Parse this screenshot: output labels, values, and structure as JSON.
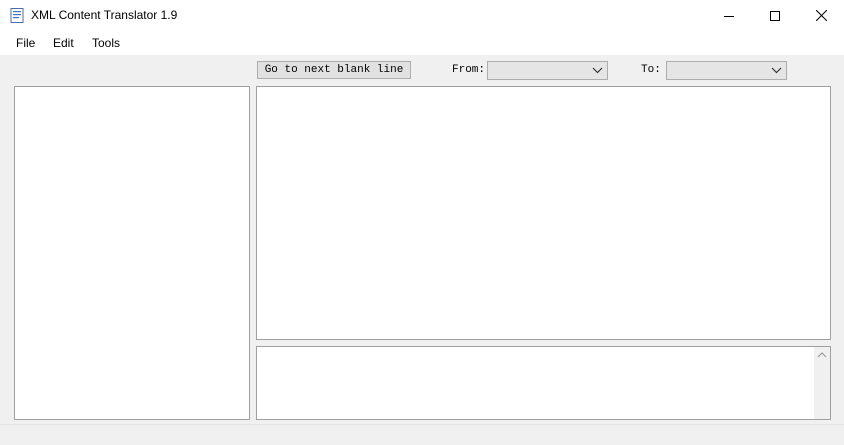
{
  "window": {
    "title": "XML Content Translator 1.9",
    "icons": [
      "app-icon",
      "minimize-icon",
      "maximize-icon",
      "close-icon"
    ]
  },
  "menu": {
    "file": "File",
    "edit": "Edit",
    "tools": "Tools"
  },
  "toolbar": {
    "goto_label": "Go to next blank line",
    "from_label": "From:",
    "to_label": "To:",
    "from_value": "",
    "to_value": ""
  },
  "colors": {
    "background": "#f0f0f0",
    "panel": "#ffffff",
    "border": "#a0a0a0",
    "button": "#e1e1e1"
  }
}
